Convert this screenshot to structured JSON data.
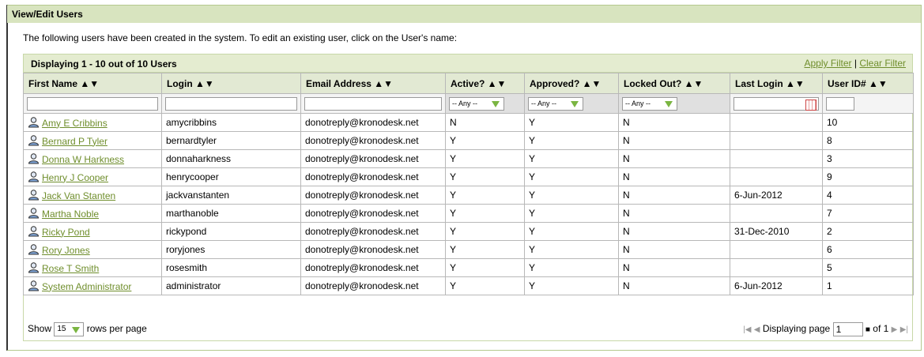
{
  "panel": {
    "title": "View/Edit Users"
  },
  "intro": "The following users have been created in the system. To edit an existing user, click on the User's name:",
  "grid": {
    "displaying": "Displaying 1 - 10 out of 10 Users",
    "apply_filter": "Apply Filter",
    "separator": "|",
    "clear_filter": "Clear Filter",
    "columns": [
      "First Name ▲▼",
      "Login ▲▼",
      "Email Address ▲▼",
      "Active? ▲▼",
      "Approved? ▲▼",
      "Locked Out? ▲▼",
      "Last Login ▲▼",
      "User ID# ▲▼"
    ],
    "filters": {
      "active": "-- Any --",
      "approved": "-- Any --",
      "locked": "-- Any --"
    },
    "rows": [
      {
        "name": "Amy E Cribbins",
        "login": "amycribbins",
        "email": "donotreply@kronodesk.net",
        "active": "N",
        "approved": "Y",
        "locked": "N",
        "last_login": "",
        "id": "10"
      },
      {
        "name": "Bernard P Tyler",
        "login": "bernardtyler",
        "email": "donotreply@kronodesk.net",
        "active": "Y",
        "approved": "Y",
        "locked": "N",
        "last_login": "",
        "id": "8"
      },
      {
        "name": "Donna W Harkness",
        "login": "donnaharkness",
        "email": "donotreply@kronodesk.net",
        "active": "Y",
        "approved": "Y",
        "locked": "N",
        "last_login": "",
        "id": "3"
      },
      {
        "name": "Henry J Cooper",
        "login": "henrycooper",
        "email": "donotreply@kronodesk.net",
        "active": "Y",
        "approved": "Y",
        "locked": "N",
        "last_login": "",
        "id": "9"
      },
      {
        "name": "Jack Van Stanten",
        "login": "jackvanstanten",
        "email": "donotreply@kronodesk.net",
        "active": "Y",
        "approved": "Y",
        "locked": "N",
        "last_login": "6-Jun-2012",
        "id": "4"
      },
      {
        "name": "Martha Noble",
        "login": "marthanoble",
        "email": "donotreply@kronodesk.net",
        "active": "Y",
        "approved": "Y",
        "locked": "N",
        "last_login": "",
        "id": "7"
      },
      {
        "name": "Ricky Pond",
        "login": "rickypond",
        "email": "donotreply@kronodesk.net",
        "active": "Y",
        "approved": "Y",
        "locked": "N",
        "last_login": "31-Dec-2010",
        "id": "2"
      },
      {
        "name": "Rory Jones",
        "login": "roryjones",
        "email": "donotreply@kronodesk.net",
        "active": "Y",
        "approved": "Y",
        "locked": "N",
        "last_login": "",
        "id": "6"
      },
      {
        "name": "Rose T Smith",
        "login": "rosesmith",
        "email": "donotreply@kronodesk.net",
        "active": "Y",
        "approved": "Y",
        "locked": "N",
        "last_login": "",
        "id": "5"
      },
      {
        "name": "System Administrator",
        "login": "administrator",
        "email": "donotreply@kronodesk.net",
        "active": "Y",
        "approved": "Y",
        "locked": "N",
        "last_login": "6-Jun-2012",
        "id": "1"
      }
    ]
  },
  "footer": {
    "show": "Show",
    "rows_per_page_value": "15",
    "rows_per_page": "rows per page",
    "displaying_page": "Displaying page",
    "page": "1",
    "of": "of 1"
  },
  "icons": {
    "user": "user-icon",
    "first": "first-page-icon",
    "prev": "prev-page-icon",
    "next": "next-page-icon",
    "last": "last-page-icon",
    "calendar": "calendar-icon",
    "refresh": "refresh-icon"
  },
  "colors": {
    "link": "#6f8e2c",
    "header_bg": "#e2e9d3",
    "title_bg": "#d8e4bf",
    "dropdown_arrow": "#7ab541"
  }
}
